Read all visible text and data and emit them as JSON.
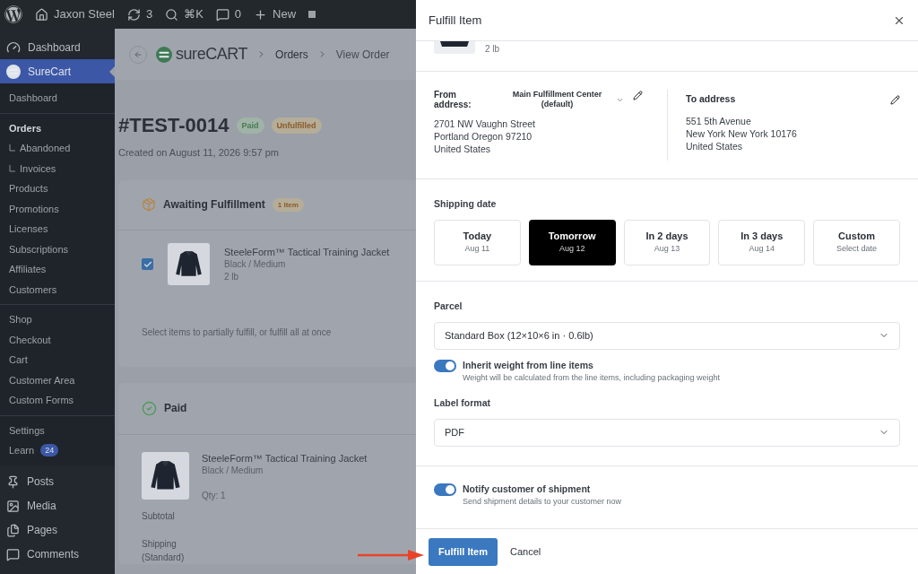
{
  "admin_bar": {
    "items": [
      {
        "kind": "wordpress"
      },
      {
        "kind": "home",
        "label": "Jaxon Steel"
      },
      {
        "kind": "updates",
        "label": "3"
      },
      {
        "kind": "search",
        "label": "⌘K"
      },
      {
        "kind": "comments",
        "label": "0"
      },
      {
        "kind": "new",
        "label": "New"
      },
      {
        "kind": "square"
      }
    ]
  },
  "sidebar": {
    "top": [
      {
        "kind": "dashboard",
        "label": "Dashboard",
        "selected": false
      },
      {
        "kind": "surecart",
        "label": "SureCart",
        "selected": true
      }
    ],
    "groups": [
      [
        {
          "label": "Dashboard",
          "selected": false
        }
      ],
      [
        {
          "label": "Orders",
          "selected": true
        },
        {
          "label": "Abandoned",
          "selected": false,
          "kind": "sub"
        },
        {
          "label": "Invoices",
          "selected": false,
          "kind": "sub"
        },
        {
          "label": "Products",
          "selected": false
        },
        {
          "label": "Promotions",
          "selected": false
        },
        {
          "label": "Licenses",
          "selected": false
        },
        {
          "label": "Subscriptions",
          "selected": false
        },
        {
          "label": "Affiliates",
          "selected": false
        },
        {
          "label": "Customers",
          "selected": false
        }
      ],
      [
        {
          "label": "Shop",
          "selected": false
        },
        {
          "label": "Checkout",
          "selected": false
        },
        {
          "label": "Cart",
          "selected": false
        },
        {
          "label": "Customer Area",
          "selected": false
        },
        {
          "label": "Custom Forms",
          "selected": false
        }
      ],
      [
        {
          "label": "Settings",
          "selected": false
        },
        {
          "label": "Learn",
          "selected": false,
          "badge": "24"
        }
      ]
    ],
    "bottom": [
      {
        "kind": "posts",
        "label": "Posts"
      },
      {
        "kind": "media",
        "label": "Media"
      },
      {
        "kind": "pages",
        "label": "Pages"
      },
      {
        "kind": "comments",
        "label": "Comments"
      }
    ]
  },
  "header": {
    "logo": "sureCART",
    "breadcrumbs": [
      "Orders",
      "View Order"
    ]
  },
  "order": {
    "number": "#TEST-0014",
    "badges": [
      {
        "label": "Paid",
        "color": "#9fb3a6"
      },
      {
        "label": "Unfulfilled",
        "color": "#b5ad98"
      }
    ],
    "created": "Created on August 11, 2026 9:57 pm"
  },
  "awaiting_card": {
    "title": "Awaiting Fulfillment",
    "badge": "1 Item",
    "item": {
      "checked": true,
      "name": "SteeleForm™ Tactical Training Jacket",
      "variant": "Black / Medium",
      "weight": "2 lb"
    },
    "footer": "Select items to partially fulfill, or fulfill all at once"
  },
  "paid_card": {
    "title": "Paid",
    "item": {
      "name": "SteeleForm™ Tactical Training Jacket",
      "variant": "Black / Medium",
      "qty": "Qty: 1"
    },
    "rows": [
      "Subtotal",
      "Shipping (Standard)"
    ]
  },
  "panel": {
    "title": "Fulfill Item",
    "partial_item": {
      "weight": "2 lb"
    },
    "from": {
      "label": "From address:",
      "location": "Main Fulfillment Center (default)",
      "lines": [
        "2701 NW Vaughn Street",
        "Portland Oregon 97210",
        "United States"
      ]
    },
    "to": {
      "label": "To address",
      "lines": [
        "551 5th Avenue",
        "New York New York 10176",
        "United States"
      ]
    },
    "shipping_date": {
      "label": "Shipping date",
      "options": [
        {
          "title": "Today",
          "sub": "Aug 11",
          "selected": false
        },
        {
          "title": "Tomorrow",
          "sub": "Aug 12",
          "selected": true
        },
        {
          "title": "In 2 days",
          "sub": "Aug 13",
          "selected": false
        },
        {
          "title": "In 3 days",
          "sub": "Aug 14",
          "selected": false
        },
        {
          "title": "Custom",
          "sub": "Select date",
          "selected": false
        }
      ]
    },
    "parcel": {
      "label": "Parcel",
      "value": "Standard Box (12×10×6 in · 0.6lb)"
    },
    "inherit": {
      "label": "Inherit weight from line items",
      "help": "Weight will be calculated from the line items, including packaging weight",
      "on": true
    },
    "label_format": {
      "label": "Label format",
      "value": "PDF"
    },
    "notify": {
      "label": "Notify customer of shipment",
      "help": "Send shipment details to your customer now",
      "on": true
    },
    "buttons": {
      "primary": "Fulfill Item",
      "secondary": "Cancel"
    }
  }
}
